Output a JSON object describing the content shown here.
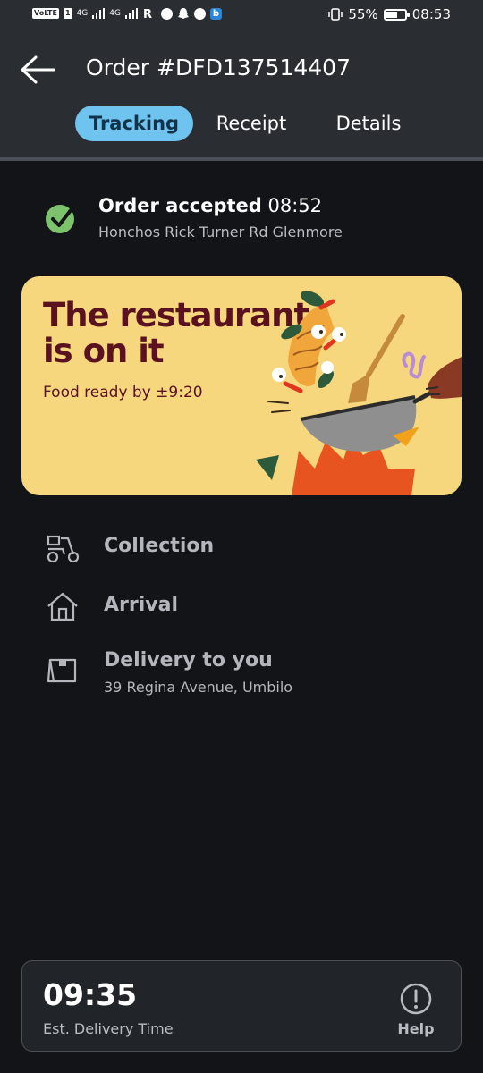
{
  "status_bar": {
    "carrier_chip": "VoLTE",
    "sim_number": "1",
    "signal1": "4G",
    "signal2": "4G",
    "battery": "55%",
    "time": "08:53"
  },
  "header": {
    "title": "Order #DFD137514407",
    "tabs": [
      {
        "label": "Tracking",
        "active": true
      },
      {
        "label": "Receipt",
        "active": false
      },
      {
        "label": "Details",
        "active": false
      }
    ]
  },
  "accepted": {
    "title": "Order accepted",
    "time": "08:52",
    "location": "Honchos Rick Turner Rd Glenmore"
  },
  "banner": {
    "title_line1": "The restaurant",
    "title_line2": "is on it",
    "subtitle": "Food ready by ±9:20",
    "background": "#f6d77d",
    "text_color": "#5b1220"
  },
  "steps": [
    {
      "label": "Collection",
      "icon": "scooter-icon"
    },
    {
      "label": "Arrival",
      "icon": "house-icon"
    },
    {
      "label": "Delivery to you",
      "icon": "package-icon",
      "address": "39 Regina Avenue, Umbilo"
    }
  ],
  "eta": {
    "time": "09:35",
    "label": "Est. Delivery Time",
    "help_label": "Help"
  },
  "colors": {
    "accent": "#6ec3ef",
    "success": "#7cc36b",
    "background": "#121417",
    "header": "#2a2d32"
  }
}
